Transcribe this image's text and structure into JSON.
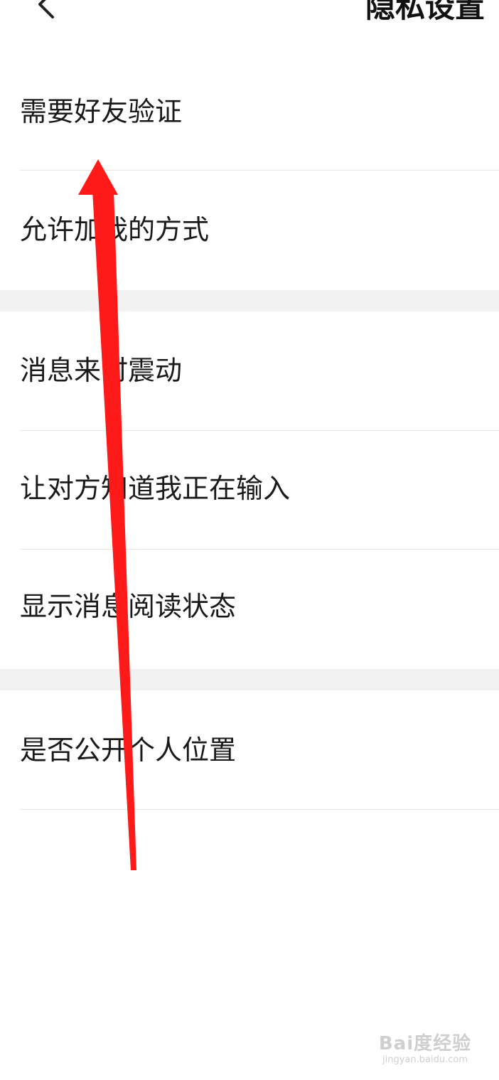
{
  "header": {
    "title": "隐私设置",
    "back_icon": "chevron-left-icon"
  },
  "section1": {
    "items": [
      {
        "label": "需要好友验证"
      },
      {
        "label": "允许加我的方式"
      }
    ]
  },
  "section2": {
    "items": [
      {
        "label": "消息来时震动"
      },
      {
        "label": "让对方知道我正在输入"
      },
      {
        "label": "显示消息阅读状态"
      }
    ]
  },
  "section3": {
    "items": [
      {
        "label": "是否公开个人位置"
      }
    ]
  },
  "annotation": {
    "arrow_color": "#ff1a1a"
  },
  "watermark": {
    "logo": "Bai度经验",
    "url": "jingyan.baidu.com"
  }
}
